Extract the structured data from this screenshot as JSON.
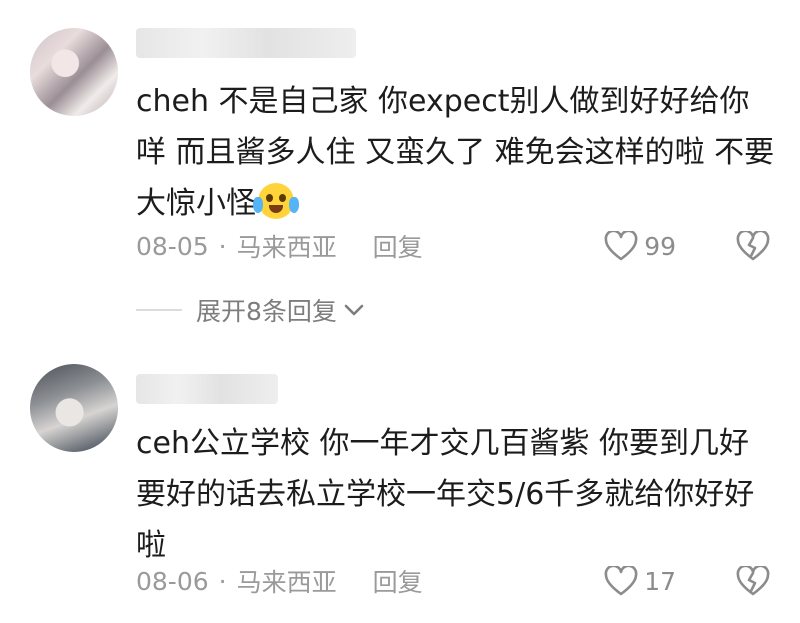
{
  "comments": [
    {
      "text": "cheh 不是自己家 你expect别人做到好好给你咩 而且酱多人住 又蛮久了 难免会这样的啦 不要大惊小怪",
      "emoji": "crying-laughing-face",
      "date": "08-05",
      "separator": "·",
      "location": "马来西亚",
      "reply_label": "回复",
      "likes": "99",
      "expand_label": "展开8条回复"
    },
    {
      "text": "ceh公立学校 你一年才交几百酱紫 你要到几好 要好的话去私立学校一年交5/6千多就给你好好啦",
      "date": "08-06",
      "separator": "·",
      "location": "马来西亚",
      "reply_label": "回复",
      "likes": "17"
    }
  ],
  "icons": {
    "like": "heart-outline-icon",
    "dislike": "broken-heart-icon",
    "expand": "chevron-down-icon"
  },
  "colors": {
    "text": "#1c1c1c",
    "meta": "#9a9a9a"
  }
}
